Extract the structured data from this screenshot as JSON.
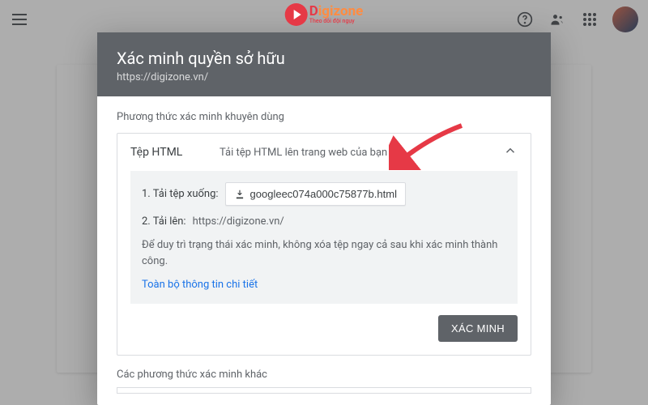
{
  "logo": {
    "brand": "Digizone",
    "tagline": "Theo dõi đội ngụy"
  },
  "dialog": {
    "title": "Xác minh quyền sở hữu",
    "subtitle": "https://digizone.vn/",
    "recommended_label": "Phương thức xác minh khuyên dùng",
    "method": {
      "name": "Tệp HTML",
      "desc": "Tải tệp HTML lên trang web của bạn",
      "step1_label": "1. Tải tệp xuống:",
      "download_file": "googleec074a000c75877b.html",
      "step2_label": "2. Tải lên:",
      "step2_url": "https://digizone.vn/",
      "note": "Để duy trì trạng thái xác minh, không xóa tệp ngay cả sau khi xác minh thành công.",
      "detail_link": "Toàn bộ thông tin chi tiết",
      "verify_button": "XÁC MINH"
    },
    "other_label": "Các phương thức xác minh khác"
  }
}
